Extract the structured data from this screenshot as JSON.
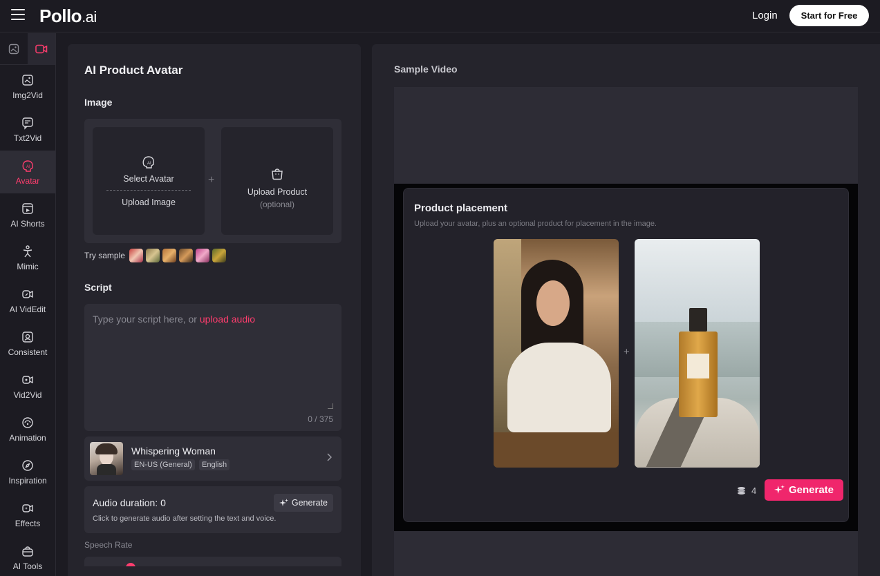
{
  "header": {
    "logo_main": "Pollo",
    "logo_suffix": ".ai",
    "login": "Login",
    "start": "Start for Free"
  },
  "sidebar": {
    "tabs": [
      "image-tab-icon",
      "video-tab-icon"
    ],
    "items": [
      {
        "label": "Img2Vid",
        "icon": "img2vid-icon"
      },
      {
        "label": "Txt2Vid",
        "icon": "txt2vid-icon"
      },
      {
        "label": "Avatar",
        "icon": "avatar-icon",
        "active": true
      },
      {
        "label": "AI Shorts",
        "icon": "shorts-icon"
      },
      {
        "label": "Mimic",
        "icon": "mimic-icon"
      },
      {
        "label": "AI VidEdit",
        "icon": "videdit-icon"
      },
      {
        "label": "Consistent",
        "icon": "consistent-icon"
      },
      {
        "label": "Vid2Vid",
        "icon": "vid2vid-icon"
      },
      {
        "label": "Animation",
        "icon": "animation-icon"
      },
      {
        "label": "Inspiration",
        "icon": "compass-icon"
      },
      {
        "label": "Effects",
        "icon": "effects-icon"
      },
      {
        "label": "AI Tools",
        "icon": "tools-icon"
      }
    ]
  },
  "left": {
    "title": "AI Product Avatar",
    "image_label": "Image",
    "select_avatar": "Select Avatar",
    "upload_image": "Upload Image",
    "upload_product": "Upload Product",
    "optional": "(optional)",
    "try_sample": "Try sample",
    "script_label": "Script",
    "script_placeholder": "Type your script here, or ",
    "upload_audio": "upload audio",
    "counter": "0 / 375",
    "voice_name": "Whispering Woman",
    "voice_tag1": "EN-US (General)",
    "voice_tag2": "English",
    "audio_duration": "Audio duration: 0",
    "audio_hint": "Click to generate audio after setting the text and voice.",
    "generate_small": "Generate",
    "speech_rate": "Speech Rate"
  },
  "right": {
    "sample_video": "Sample Video",
    "pp_title": "Product placement",
    "pp_subtitle": "Upload your avatar, plus an optional product for placement in the image.",
    "credits": "4",
    "generate": "Generate"
  },
  "colors": {
    "accent": "#ff3d6e",
    "generate_bg": "#f0266c",
    "bg": "#1c1b22",
    "panel": "#25242c"
  }
}
